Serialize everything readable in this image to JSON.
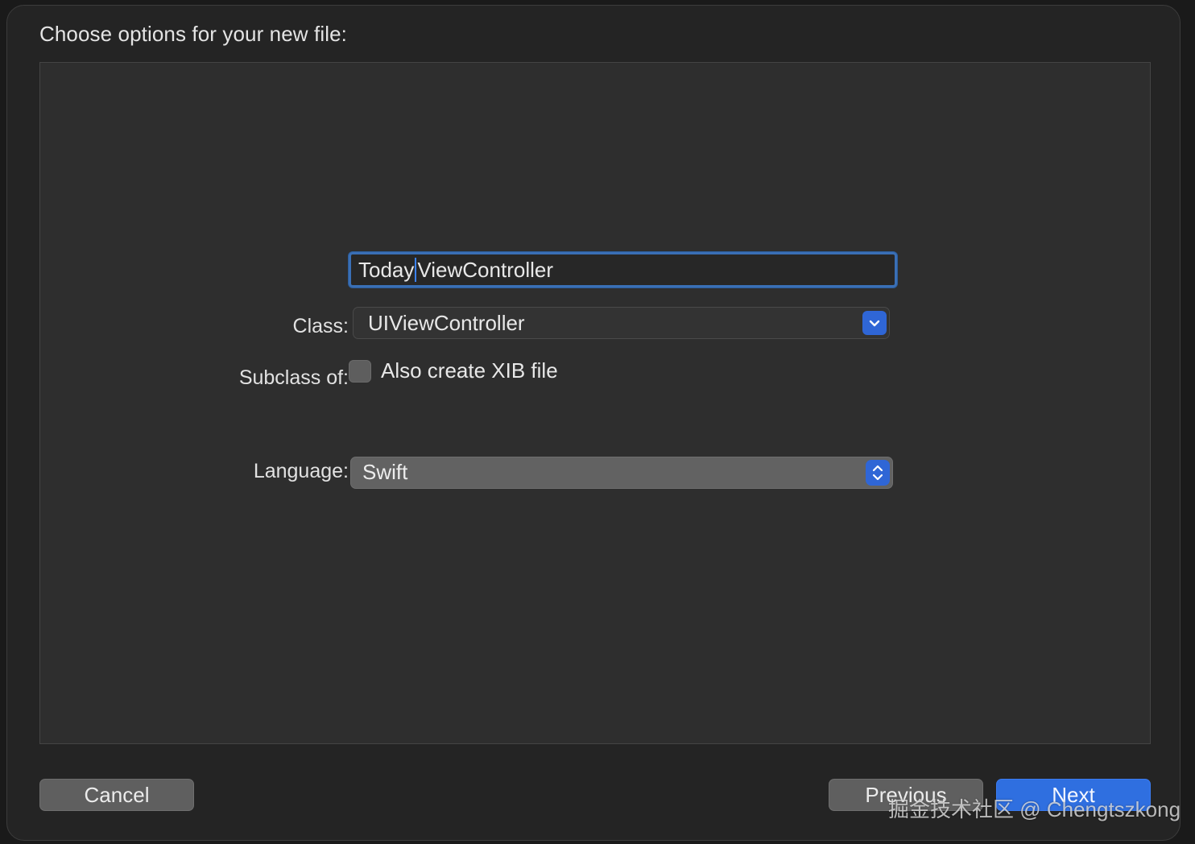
{
  "dialog": {
    "title": "Choose options for your new file:"
  },
  "form": {
    "class_label": "Class:",
    "class_value_before_caret": "Today",
    "class_value_after_caret": "ViewController",
    "subclass_label": "Subclass of:",
    "subclass_value": "UIViewController",
    "xib_checkbox_label": "Also create XIB file",
    "xib_checked": false,
    "language_label": "Language:",
    "language_value": "Swift"
  },
  "buttons": {
    "cancel": "Cancel",
    "previous": "Previous",
    "next": "Next"
  },
  "watermark": "掘金技术社区 @ Chengtszkong",
  "colors": {
    "accent": "#2f6fe0",
    "focus_ring": "#3a6fb5",
    "sheet_bg": "#242424",
    "panel_bg": "#2e2e2e"
  },
  "icons": {
    "subclass_popup": "chevron-down-icon",
    "language_popup": "up-down-chevrons-icon"
  }
}
